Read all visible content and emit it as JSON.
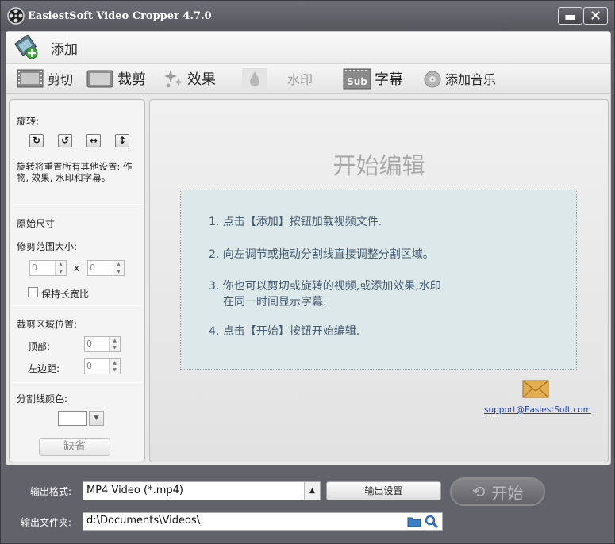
{
  "window": {
    "title": "EasiestSoft Video Cropper 4.7.0",
    "min_label": "▬",
    "close_label": "✕"
  },
  "addbar": {
    "add_label": "添加"
  },
  "tools": [
    {
      "label": "剪切",
      "icon": "film-strip-icon"
    },
    {
      "label": "裁剪",
      "icon": "crop-screen-icon"
    },
    {
      "label": "效果",
      "icon": "sparkle-icon"
    },
    {
      "label": "水印",
      "icon": "water-drop-icon"
    },
    {
      "label": "字幕",
      "icon": "subtitle-icon"
    },
    {
      "label": "添加音乐",
      "icon": "music-disc-icon"
    }
  ],
  "left": {
    "rotate_label": "旋转:",
    "rotate_note_1": "旋转将重置所有其他设置: 作",
    "rotate_note_2": "物, 效果, 水印和字幕。",
    "orig_size": "原始尺寸",
    "crop_size": "修剪范围大小:",
    "width_value": "0",
    "x_label": "x",
    "height_value": "0",
    "keep_ratio": "保持长宽比",
    "crop_pos": "裁剪区域位置:",
    "top_label": "顶部:",
    "top_value": "0",
    "left_label": "左边距:",
    "left_value": "0",
    "line_color": "分割线颜色:",
    "line_color_value": "#ffffff",
    "reset": "缺省"
  },
  "editor": {
    "title": "开始编辑",
    "steps": [
      "1. 点击【添加】按钮加载视频文件.",
      "2. 向左调节或拖动分割线直接调整分割区域。",
      "3. 你也可以剪切或旋转的视频,或添加效果,水印",
      "在同一时间显示字幕.",
      "4. 点击【开始】按钮开始编辑."
    ],
    "support": "support@EasiestSoft.com"
  },
  "bottom": {
    "format_label": "输出格式:",
    "format_value": "MP4 Video (*.mp4)",
    "settings_label": "输出设置",
    "start_label": "开始",
    "folder_label": "输出文件夹:",
    "folder_value": "d:\\Documents\\Videos\\"
  }
}
